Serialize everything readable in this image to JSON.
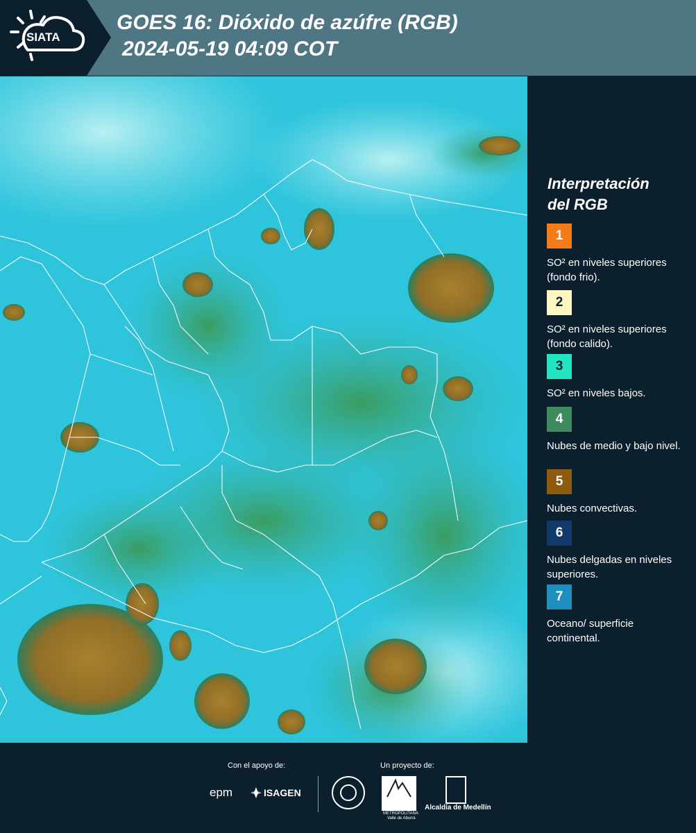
{
  "header": {
    "logo_text": "SIATA",
    "title_line1": "GOES 16: Dióxido de azúfre (RGB)",
    "title_line2": "2024-05-19 04:09 COT"
  },
  "legend": {
    "title_line1": "Interpretación",
    "title_line2": "del RGB",
    "items": [
      {
        "num": "1",
        "text": "SO² en niveles superiores (fondo frio).",
        "color": "#f47d1a"
      },
      {
        "num": "2",
        "text": "SO² en niveles superiores (fondo calido).",
        "color": "#fdf6c3"
      },
      {
        "num": "3",
        "text": "SO² en niveles bajos.",
        "color": "#21e6c1"
      },
      {
        "num": "4",
        "text": "Nubes de medio y bajo nivel.",
        "color": "#3e8b5e"
      },
      {
        "num": "5",
        "text": "Nubes convectivas.",
        "color": "#8e5a10"
      },
      {
        "num": "6",
        "text": "Nubes delgadas en niveles superiores.",
        "color": "#113a6b"
      },
      {
        "num": "7",
        "text": "Oceano/ superficie continental.",
        "color": "#1f8fbd"
      }
    ]
  },
  "footer": {
    "support_label": "Con el apoyo de:",
    "project_label": "Un proyecto de:",
    "epm": "epm",
    "isagen": "ISAGEN",
    "metro_label": "METROPOLITANA",
    "metro_sub": "Valle de Aburrá",
    "alcaldia": "Alcaldía de Medellín"
  },
  "colors": {
    "background": "#0c1f2d",
    "header": "#4f7683",
    "ocean": "#2ec4dc",
    "cloud_convective": "#9a7b2a",
    "cloud_low": "#3e9f6a"
  }
}
